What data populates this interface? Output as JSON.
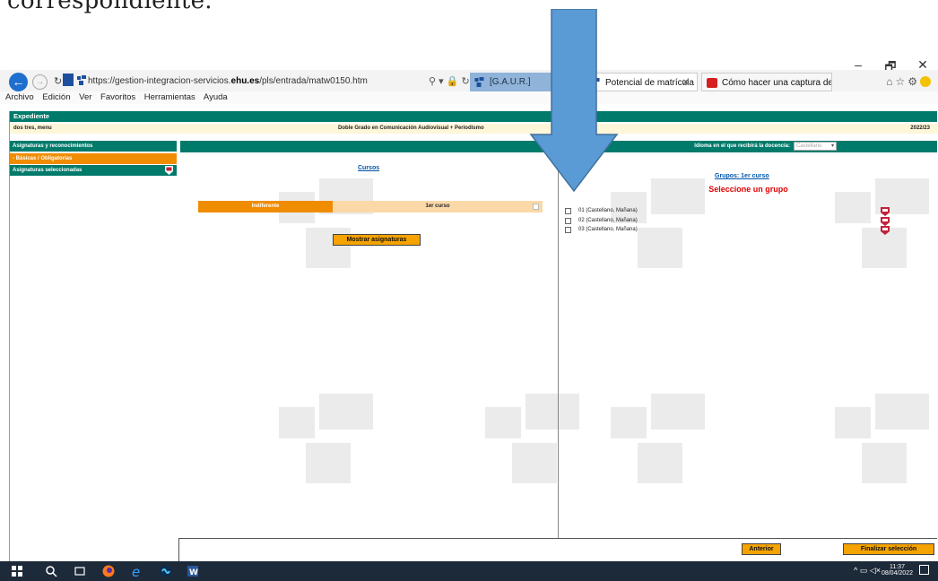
{
  "document": {
    "text_above": "correspondiente."
  },
  "browser": {
    "url_prefix": "https://gestion-integracion-servicios.",
    "url_domain": "ehu.es",
    "url_path": "/pls/entrada/matw0150.htm",
    "tabs": [
      {
        "label": "[G.A.U.R.]",
        "icon": "ehu-logo-icon"
      },
      {
        "label": "Potencial de matrícula",
        "icon": "ehu-logo-icon"
      },
      {
        "label": "Cómo hacer una captura de pa...",
        "icon": "red-document-icon"
      }
    ],
    "menu": [
      "Archivo",
      "Edición",
      "Ver",
      "Favoritos",
      "Herramientas",
      "Ayuda"
    ],
    "window_controls": [
      "–",
      "🗗",
      "✕"
    ]
  },
  "app": {
    "title": "Expediente",
    "student_name": "dos tres, menu",
    "degree": "Doble Grado en Comunicación Audiovisual + Periodismo",
    "academic_year": "2022/23",
    "sidebar": {
      "section_label": "Asignaturas y reconocimientos",
      "items": [
        "- Básicas / Obligatorias",
        "Asignaturas seleccionadas"
      ]
    },
    "language_prompt": "Idioma en el que recibirá la docencia:",
    "language_value": "Castellano",
    "courses": {
      "title": "Cursos",
      "option_indifferent": "Indiferente",
      "option_course": "1er curso",
      "show_button": "Mostrar asignaturas"
    },
    "groups": {
      "title": "Grupos:    1er curso",
      "prompt": "Seleccione un grupo",
      "items": [
        "01 (Castellano, Mañana)",
        "02 (Castellano, Mañana)",
        "03 (Castellano, Mañana)"
      ]
    },
    "footer": {
      "previous_button": "Anterior",
      "finish_button": "Finalizar selección"
    }
  },
  "taskbar": {
    "time": "11:37",
    "date": "08/04/2022"
  },
  "colors": {
    "teal": "#007a6b",
    "orange": "#f08c00",
    "light_orange": "#fbd8a8",
    "arrow_blue": "#5b9bd5",
    "red": "#e00000"
  }
}
